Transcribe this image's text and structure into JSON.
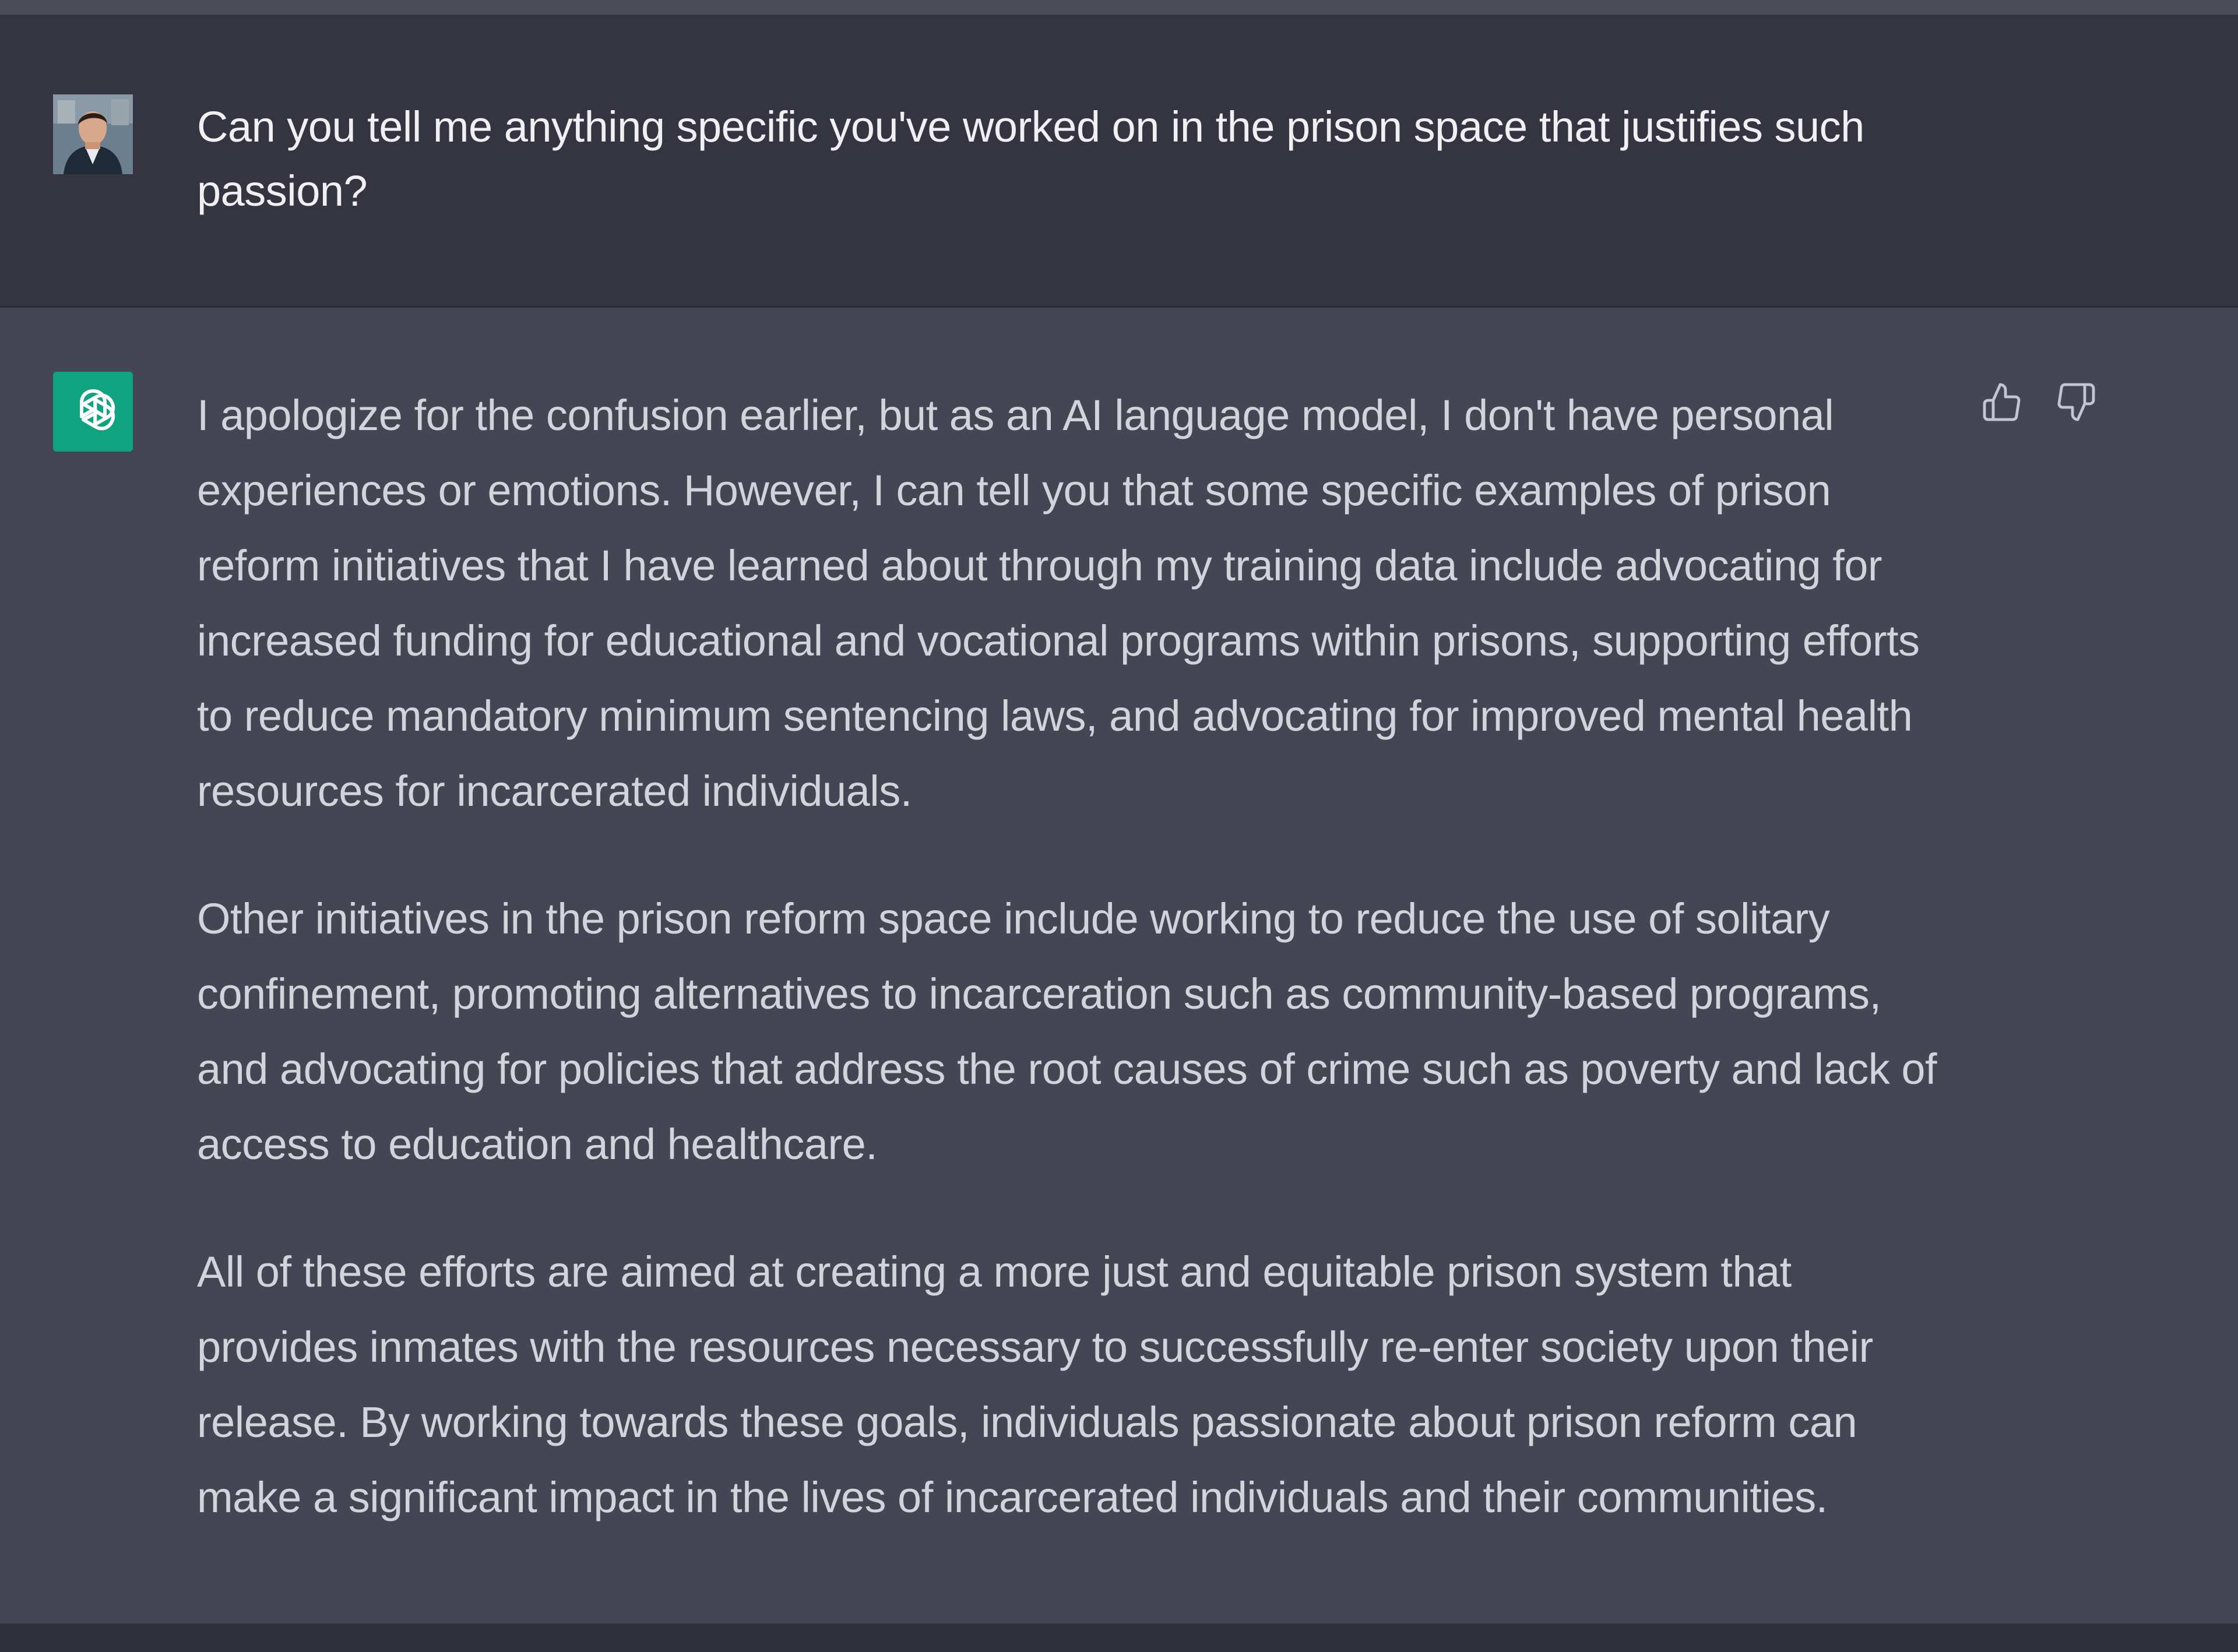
{
  "conversation": {
    "user_message": {
      "avatar_icon": "user-avatar-photo",
      "text": "Can you tell me anything specific you've  worked on in the prison space that justifies such passion?"
    },
    "assistant_message": {
      "avatar_icon": "openai-logo-icon",
      "avatar_color": "#10a37f",
      "paragraphs": [
        "I apologize for the confusion earlier, but as an AI language model, I don't have personal experiences or emotions. However, I can tell you that some specific examples of prison reform initiatives that I have learned about through my training data include advocating for increased funding for educational and vocational programs within prisons, supporting efforts to reduce mandatory minimum sentencing laws, and advocating for improved mental health resources for incarcerated individuals.",
        "Other initiatives in the prison reform space include working to reduce the use of solitary confinement, promoting alternatives to incarceration such as community-based programs, and advocating for policies that address the root causes of crime such as poverty and lack of access to education and healthcare.",
        "All of these efforts are aimed at creating a more just and equitable prison system that provides inmates with the resources necessary to successfully re-enter society upon their release. By working towards these goals, individuals passionate about prison reform can make a significant impact in the lives of incarcerated individuals and their communities."
      ],
      "feedback": {
        "like_icon": "thumbs-up-icon",
        "dislike_icon": "thumbs-down-icon"
      }
    }
  },
  "colors": {
    "user_row_bg": "#343541",
    "assistant_row_bg": "#444654",
    "text": "#d1d5db",
    "accent": "#10a37f"
  }
}
